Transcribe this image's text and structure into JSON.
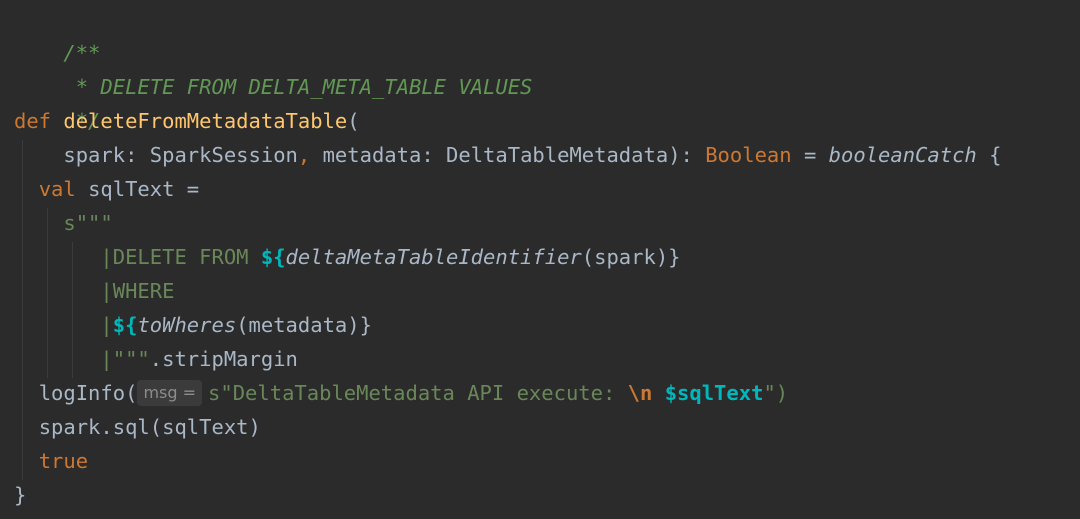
{
  "code": {
    "comment_open": "/**",
    "comment_body": " * DELETE FROM DELTA_META_TABLE VALUES",
    "comment_close": " */",
    "def_kw": "def ",
    "fn_name": "deleteFromMetadataTable",
    "paren_open": "(",
    "params_indent": "    ",
    "param_spark": "spark",
    "colon_sp": ": ",
    "type_spark": "SparkSession",
    "comma": ", ",
    "param_metadata": "metadata",
    "type_metadata": "DeltaTableMetadata",
    "close_colon": "): ",
    "ret_type": "Boolean",
    "eq": " = ",
    "boolean_catch": "booleanCatch",
    "brace_open": " {",
    "val_indent": "  ",
    "val_kw": "val ",
    "val_name": "sqlText =",
    "s_prefix_indent": "    ",
    "s_prefix": "s\"\"\"",
    "l1_indent": "       ",
    "bar": "|",
    "delete_from": "DELETE FROM ",
    "interp_open": "${",
    "delta_ident_fn": "deltaMetaTableIdentifier",
    "delta_ident_args": "(spark)",
    "interp_close": "}",
    "where": "WHERE",
    "to_wheres_fn": "toWheres",
    "to_wheres_args": "(metadata)",
    "triple_quote": "\"\"\"",
    "strip_margin": ".stripMargin",
    "loginfo": "logInfo(",
    "hint_msg": "msg =",
    "s_quote": "s\"",
    "log_text": "DeltaTableMetadata API execute: ",
    "newline_esc": "\\n",
    "space": " ",
    "interp_var": "$sqlText",
    "close_quote_paren": "\")",
    "spark_sql": "spark.sql(sqlText)",
    "true_kw": "true",
    "brace_close": "}"
  }
}
